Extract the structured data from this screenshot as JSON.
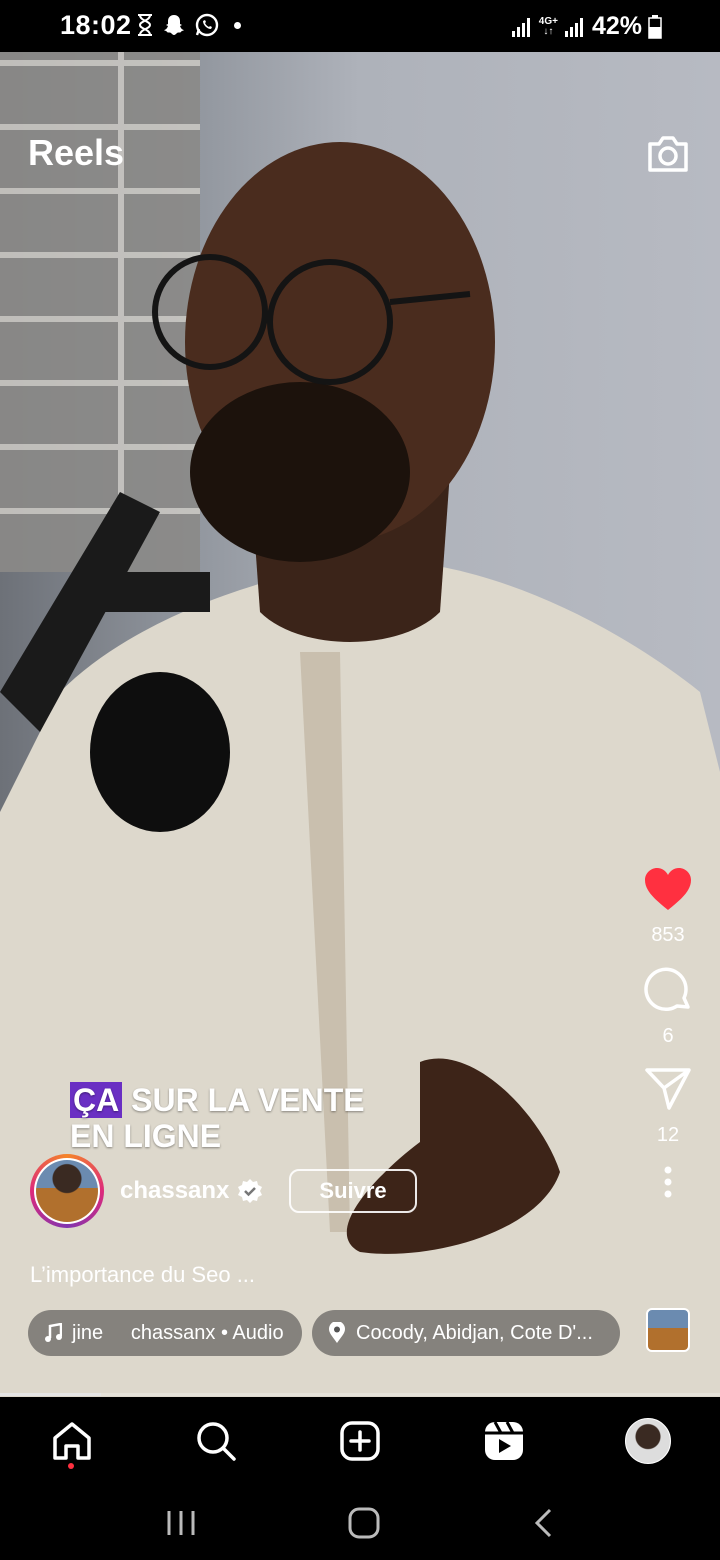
{
  "status_bar": {
    "time": "18:02",
    "network": "4G+",
    "battery": "42%"
  },
  "header": {
    "title": "Reels"
  },
  "video": {
    "caption_highlight": "ÇA",
    "caption_line1_rest": "SUR LA VENTE",
    "caption_line2": "EN LIGNE"
  },
  "actions": {
    "likes": "853",
    "comments": "6",
    "shares": "12"
  },
  "post": {
    "username": "chassanx",
    "follow_label": "Suivre",
    "description": "L’importance du Seo ...",
    "audio": "jine     chassanx • Audio",
    "location": "Cocody, Abidjan, Cote D'..."
  },
  "playback": {
    "progress_fraction": 0.14
  },
  "colors": {
    "like": "#ff3040",
    "caption_highlight": "#6a2fc3"
  },
  "icons": [
    "camera-icon",
    "heart-icon",
    "comment-icon",
    "share-icon",
    "more-icon",
    "music-icon",
    "location-icon",
    "home-icon",
    "search-icon",
    "create-icon",
    "reels-icon"
  ]
}
